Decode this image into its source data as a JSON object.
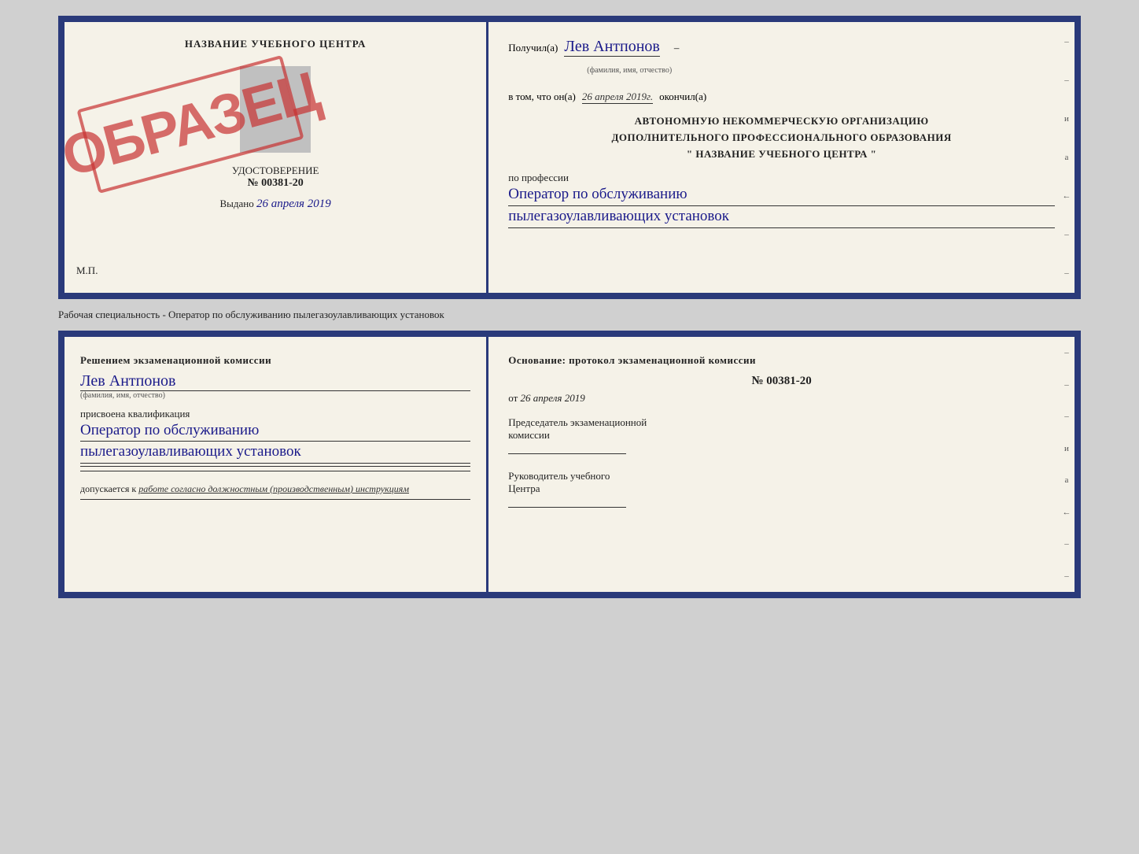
{
  "top_cert": {
    "left": {
      "school_name": "НАЗВАНИЕ УЧЕБНОГО ЦЕНТРА",
      "cert_title": "УДОСТОВЕРЕНИЕ",
      "cert_number": "№ 00381-20",
      "issued_label": "Выдано",
      "issued_date": "26 апреля 2019",
      "mp_label": "М.П."
    },
    "right": {
      "received_label": "Получил(а)",
      "received_name": "Лев Антпонов",
      "fio_sublabel": "(фамилия, имя, отчество)",
      "in_that_label": "в том, что он(а)",
      "completion_date": "26 апреля 2019г.",
      "finished_label": "окончил(а)",
      "org_line1": "АВТОНОМНУЮ НЕКОММЕРЧЕСКУЮ ОРГАНИЗАЦИЮ",
      "org_line2": "ДОПОЛНИТЕЛЬНОГО ПРОФЕССИОНАЛЬНОГО ОБРАЗОВАНИЯ",
      "org_line3": "\"  НАЗВАНИЕ УЧЕБНОГО ЦЕНТРА  \"",
      "profession_label": "по профессии",
      "profession_line1": "Оператор по обслуживанию",
      "profession_line2": "пылегазоулавливающих установок"
    },
    "stamp": "ОБРАЗЕЦ"
  },
  "middle_label": "Рабочая специальность - Оператор по обслуживанию пылегазоулавливающих установок",
  "bottom_cert": {
    "left": {
      "decision_text": "Решением экзаменационной комиссии",
      "name": "Лев Антпонов",
      "fio_sublabel": "(фамилия, имя, отчество)",
      "qualification_label": "присвоена квалификация",
      "qual_line1": "Оператор по обслуживанию",
      "qual_line2": "пылегазоулавливающих установок",
      "допускается_label": "допускается к",
      "допускается_value": "работе согласно должностным (производственным) инструкциям"
    },
    "right": {
      "osnov_label": "Основание: протокол экзаменационной комиссии",
      "protocol_number": "№  00381-20",
      "date_prefix": "от",
      "date_value": "26 апреля 2019",
      "chairman_line1": "Председатель экзаменационной",
      "chairman_line2": "комиссии",
      "leader_line1": "Руководитель учебного",
      "leader_line2": "Центра"
    }
  },
  "side_marks": [
    "-",
    "-",
    "-",
    "и",
    "а",
    "←",
    "-",
    "-",
    "-",
    "-"
  ]
}
